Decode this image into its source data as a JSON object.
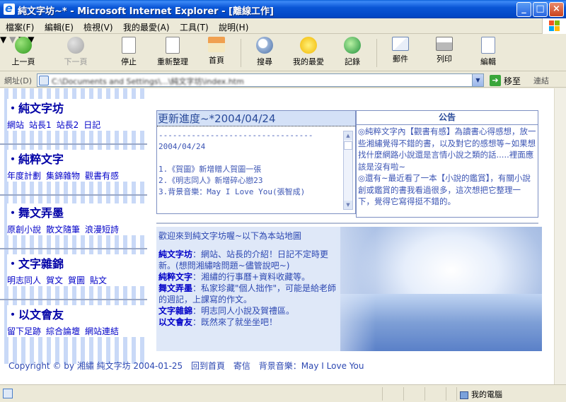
{
  "window": {
    "title": "純文字坊~* - Microsoft Internet Explorer - [離線工作]",
    "min_label": "_",
    "max_label": "□",
    "close_label": "×"
  },
  "menu": [
    "檔案(F)",
    "編輯(E)",
    "檢視(V)",
    "我的最愛(A)",
    "工具(T)",
    "說明(H)"
  ],
  "toolbar": {
    "back": "上一頁",
    "forward": "下一頁",
    "stop": "停止",
    "refresh": "重新整理",
    "home": "首頁",
    "search": "搜尋",
    "favorites": "我的最愛",
    "history": "記錄",
    "mail": "郵件",
    "print": "列印",
    "edit": "編輯"
  },
  "address": {
    "label": "網址(D)",
    "url": "C:\\Documents and Settings\\...\\純文字坊\\index.htm",
    "go_label": "移至",
    "links_label": "連結"
  },
  "nav": [
    {
      "title": "純文字坊",
      "links": [
        "網站",
        "站長1",
        "站長2",
        "日記"
      ]
    },
    {
      "title": "純粹文字",
      "links": [
        "年度計劃",
        "集錦雜物",
        "觀書有感"
      ]
    },
    {
      "title": "舞文弄墨",
      "links": [
        "原創小說",
        "散文隨筆",
        "浪漫短詩"
      ]
    },
    {
      "title": "文字雜錦",
      "links": [
        "明志同人",
        "賀文",
        "賀圖",
        "貼文"
      ]
    },
    {
      "title": "以文會友",
      "links": [
        "留下足跡",
        "綜合論壇",
        "網站連結"
      ]
    }
  ],
  "update": {
    "title": "更新進度~*2004/04/24",
    "separator": "---------------------------------",
    "date": "2004/04/24",
    "items": [
      "1.《賀圖》新增贈人賀圖一張",
      "2.《明志同人》新增碎心戀23",
      "3.背景音樂：May I Love You(張智成)"
    ]
  },
  "notice": {
    "title": "公告",
    "p1": "◎純粹文字內【觀書有感】為讀書心得感想，放一些湘繡覺得不錯的書，以及對它的感想等~如果想找什麼網路小說還是言情小說之類的話.....裡面應該是沒有啦~",
    "p2": "◎還有~最近看了一本【小說的鑑賞】，有關小說創或鑑賞的書我看過很多，這次想把它整理一下，覺得它寫得挺不錯的。"
  },
  "sitemap": {
    "intro": "歡迎來到純文字坊喔~以下為本站地圖",
    "entries": [
      {
        "name": "純文字坊",
        "desc": "：網站、站長的介紹！日記不定時更新。(想問湘繡啥問題~儘管說吧~)"
      },
      {
        "name": "純粹文字",
        "desc": "：湘繡的行事曆+資料收藏等。"
      },
      {
        "name": "舞文弄墨",
        "desc": "：私家珍藏\"個人拙作\"，可能是給老師的週記，上課寫的作文。"
      },
      {
        "name": "文字雜錦",
        "desc": "：明志同人小說及賀禮區。"
      },
      {
        "name": "以文會友",
        "desc": "：既然來了就坐坐吧！"
      }
    ]
  },
  "footer": {
    "copyright": "Copyright © by 湘繡  純文字坊  2004-01-25",
    "home_link": "回到首頁",
    "mail_link": "寄信",
    "bgm": "背景音樂：May I Love You"
  },
  "status": {
    "zone": "我的電腦"
  },
  "colors": {
    "xp_blue": "#0a56d6",
    "nav_head": "#0000a6",
    "link": "#0000c8",
    "body_text": "#3c55b4",
    "panel_border": "#7d8fc2"
  }
}
